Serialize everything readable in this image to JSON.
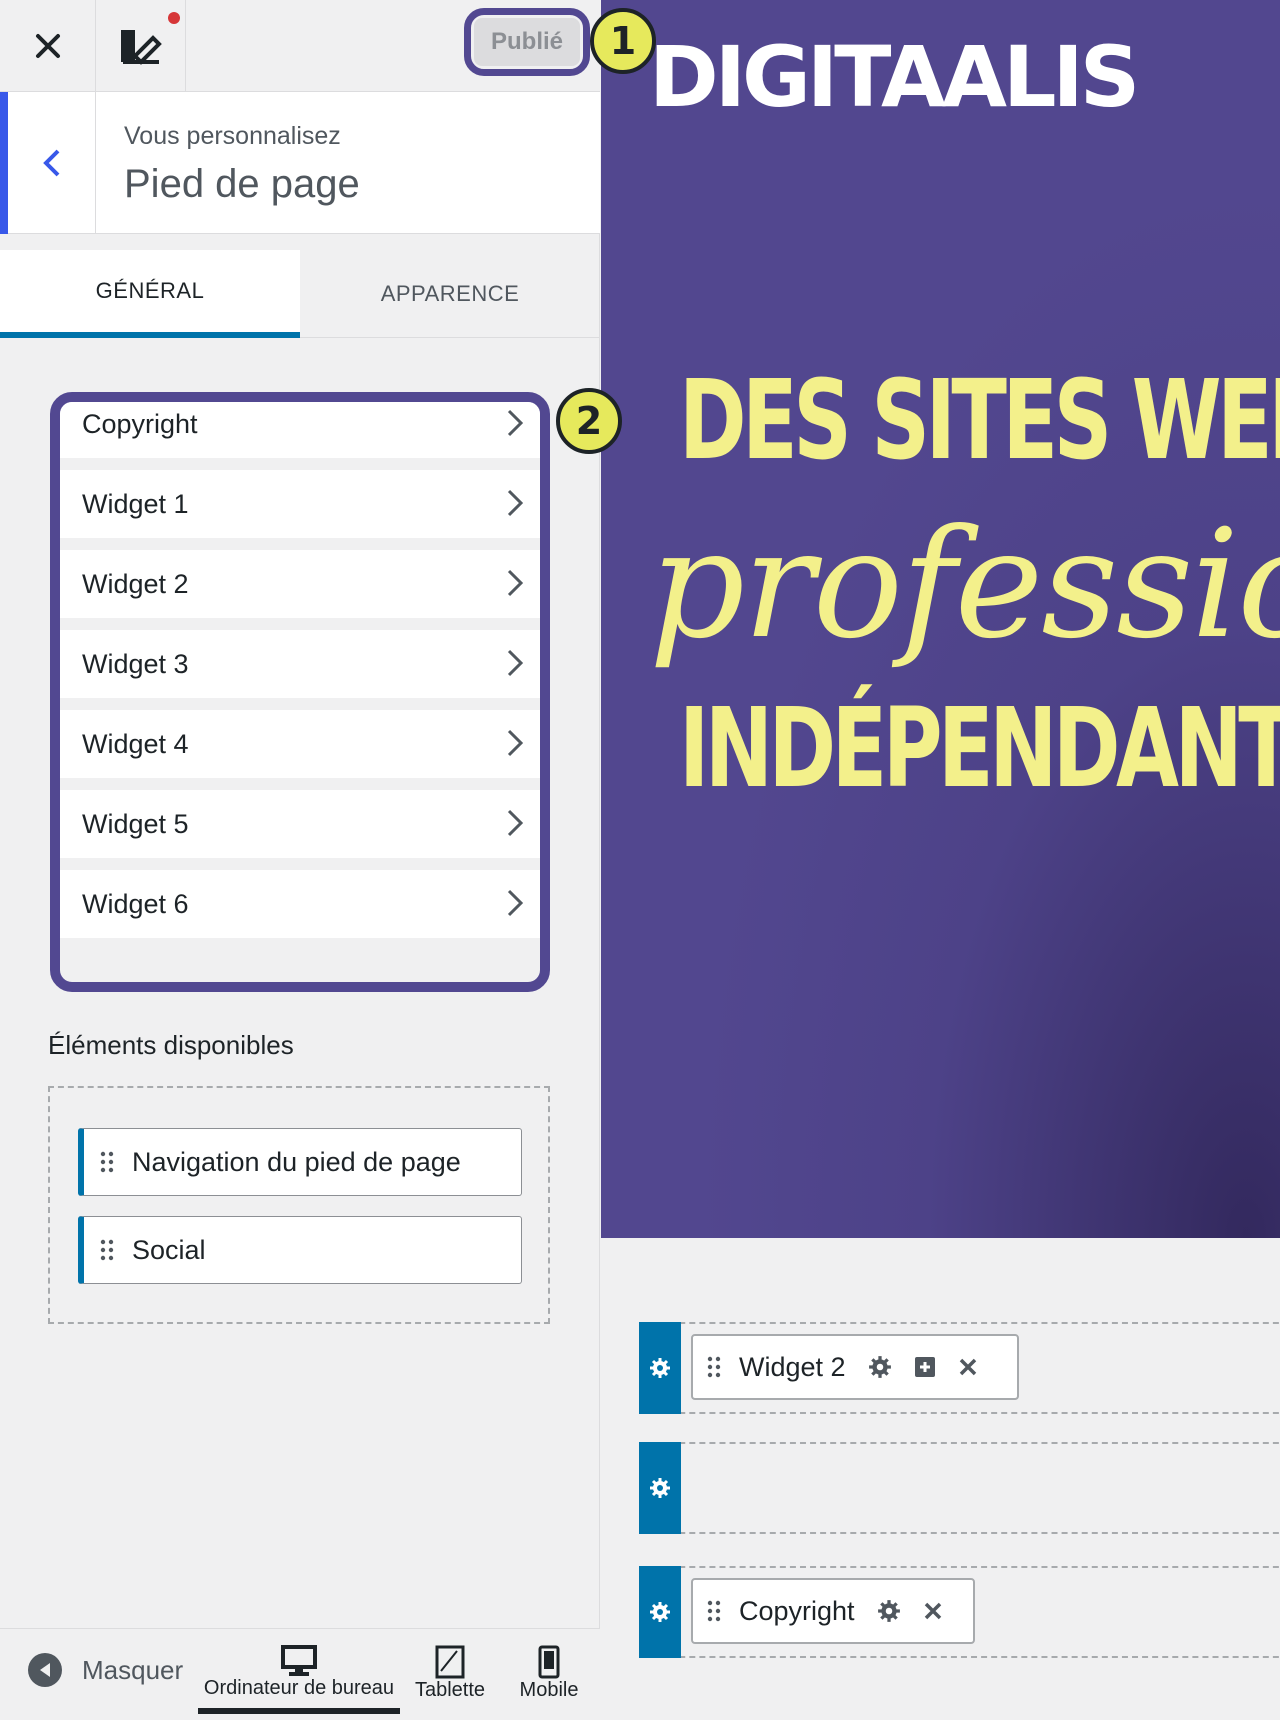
{
  "topbar": {
    "close_label": "Fermer",
    "publish_label": "Publié",
    "badge_1": "1"
  },
  "section": {
    "subtitle": "Vous personnalisez",
    "title": "Pied de page"
  },
  "tabs": [
    {
      "label": "GÉNÉRAL",
      "active": true
    },
    {
      "label": "APPARENCE",
      "active": false
    }
  ],
  "footer_items": [
    {
      "label": "Copyright"
    },
    {
      "label": "Widget 1"
    },
    {
      "label": "Widget 2"
    },
    {
      "label": "Widget 3"
    },
    {
      "label": "Widget 4"
    },
    {
      "label": "Widget 5"
    },
    {
      "label": "Widget 6"
    }
  ],
  "badge_2": "2",
  "available": {
    "title": "Éléments disponibles",
    "items": [
      {
        "label": "Navigation du pied de page"
      },
      {
        "label": "Social"
      }
    ]
  },
  "bottom": {
    "hide_label": "Masquer",
    "devices": [
      {
        "label": "Ordinateur de bureau",
        "icon": "desktop-icon",
        "active": true
      },
      {
        "label": "Tablette",
        "icon": "tablet-icon",
        "active": false
      },
      {
        "label": "Mobile",
        "icon": "mobile-icon",
        "active": false
      }
    ]
  },
  "preview": {
    "logo": "DIGITAALIS",
    "hero_line1": "DES SITES WEB",
    "hero_script": "professionnels",
    "hero_line3": "INDÉPENDANTS",
    "rows": [
      {
        "chip_label": "Widget 2"
      },
      {
        "chip_label": ""
      },
      {
        "chip_label": "Copyright"
      }
    ]
  },
  "colors": {
    "highlight_frame": "#524891",
    "badge_fill": "#e6e95c",
    "accent_blue": "#0073aa",
    "back_accent": "#3858e9",
    "hero_text": "#f3f08b",
    "hero_bg": "#52478f"
  }
}
